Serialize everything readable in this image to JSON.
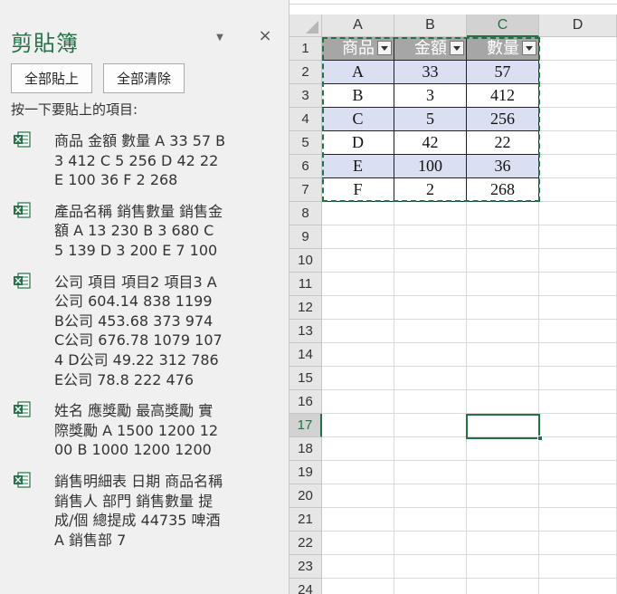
{
  "clipboard": {
    "title": "剪貼簿",
    "dropdown_icon": "▼",
    "close_icon": "×",
    "paste_all_label": "全部貼上",
    "clear_all_label": "全部清除",
    "instruction": "按一下要貼上的項目:",
    "items": [
      {
        "icon": "excel-icon",
        "text": "商品 金額 數量 A 33 57 B 3 412 C 5 256 D 42 22 E 100 36 F 2 268"
      },
      {
        "icon": "excel-icon",
        "text": "產品名稱 銷售數量 銷售金額 A 13 230 B 3 680 C 5 139 D 3 200 E 7 100"
      },
      {
        "icon": "excel-icon",
        "text": "公司 項目 項目2 項目3 A公司 604.14 838 1199 B公司 453.68 373 974 C公司 676.78 1079 1074 D公司 49.22 312 786 E公司 78.8 222 476"
      },
      {
        "icon": "excel-icon",
        "text": "姓名 應獎勵 最高獎勵 實際獎勵 A 1500 1200 1200 B 1000 1200 1200"
      },
      {
        "icon": "excel-icon",
        "text": "銷售明細表 日期 商品名稱 銷售人 部門 銷售數量 提成/個 總提成 44735 啤酒 A 銷售部 7"
      }
    ]
  },
  "sheet": {
    "columns": [
      "A",
      "B",
      "C",
      "D"
    ],
    "selected_column": "C",
    "rows": [
      "1",
      "2",
      "3",
      "4",
      "5",
      "6",
      "7",
      "8",
      "9",
      "10",
      "11",
      "12",
      "13",
      "14",
      "15",
      "16",
      "17",
      "18",
      "19",
      "20",
      "21",
      "22",
      "23",
      "24"
    ],
    "selected_row": "17",
    "table_headers": [
      "商品",
      "金額",
      "數量"
    ],
    "table_rows": [
      [
        "A",
        "33",
        "57"
      ],
      [
        "B",
        "3",
        "412"
      ],
      [
        "C",
        "5",
        "256"
      ],
      [
        "D",
        "42",
        "22"
      ],
      [
        "E",
        "100",
        "36"
      ],
      [
        "F",
        "2",
        "268"
      ]
    ],
    "active_cell": "C17",
    "colors": {
      "accent": "#217346",
      "table_header_bg": "#a6a6a6",
      "band_bg": "#dae0f2"
    }
  }
}
